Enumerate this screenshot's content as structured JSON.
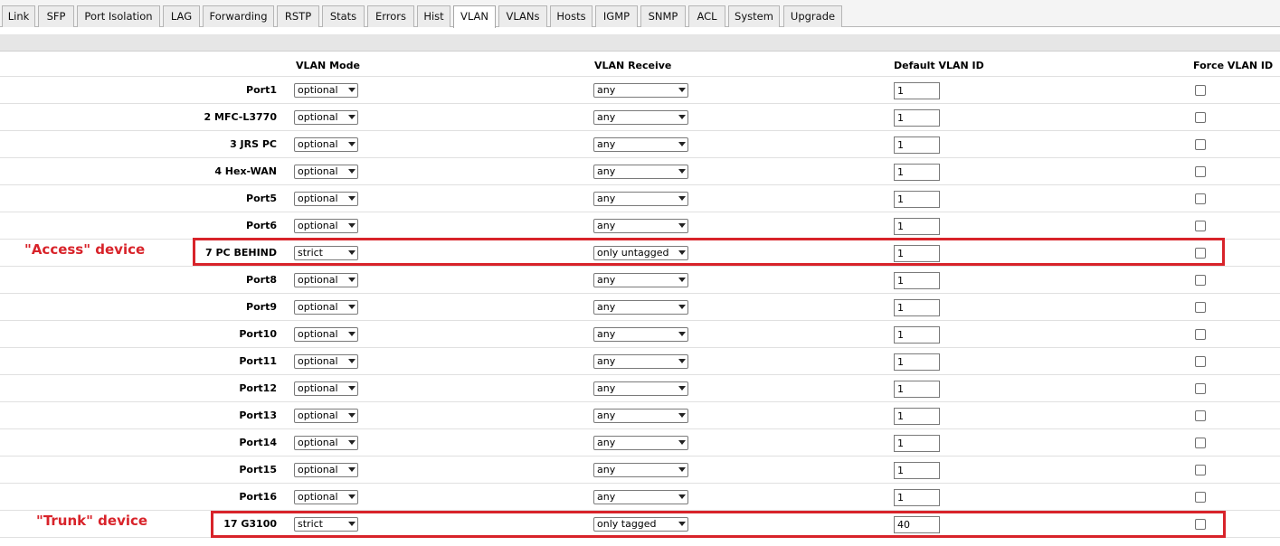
{
  "tabs": [
    {
      "label": "Link",
      "active": false
    },
    {
      "label": "SFP",
      "active": false
    },
    {
      "label": "Port Isolation",
      "active": false
    },
    {
      "label": "LAG",
      "active": false
    },
    {
      "label": "Forwarding",
      "active": false
    },
    {
      "label": "RSTP",
      "active": false
    },
    {
      "label": "Stats",
      "active": false
    },
    {
      "label": "Errors",
      "active": false
    },
    {
      "label": "Hist",
      "active": false
    },
    {
      "label": "VLAN",
      "active": true
    },
    {
      "label": "VLANs",
      "active": false
    },
    {
      "label": "Hosts",
      "active": false
    },
    {
      "label": "IGMP",
      "active": false
    },
    {
      "label": "SNMP",
      "active": false
    },
    {
      "label": "ACL",
      "active": false
    },
    {
      "label": "System",
      "active": false
    },
    {
      "label": "Upgrade",
      "active": false
    }
  ],
  "table": {
    "headers": {
      "vlan_mode": "VLAN Mode",
      "vlan_receive": "VLAN Receive",
      "default_vlan_id": "Default VLAN ID",
      "force_vlan_id": "Force VLAN ID"
    },
    "rows": [
      {
        "port": "Port1",
        "mode": "optional",
        "receive": "any",
        "vlan_id": "1",
        "force": false
      },
      {
        "port": "2 MFC-L3770",
        "mode": "optional",
        "receive": "any",
        "vlan_id": "1",
        "force": false
      },
      {
        "port": "3 JRS PC",
        "mode": "optional",
        "receive": "any",
        "vlan_id": "1",
        "force": false
      },
      {
        "port": "4 Hex-WAN",
        "mode": "optional",
        "receive": "any",
        "vlan_id": "1",
        "force": false
      },
      {
        "port": "Port5",
        "mode": "optional",
        "receive": "any",
        "vlan_id": "1",
        "force": false
      },
      {
        "port": "Port6",
        "mode": "optional",
        "receive": "any",
        "vlan_id": "1",
        "force": false
      },
      {
        "port": "7 PC BEHIND",
        "mode": "strict",
        "receive": "only untagged",
        "vlan_id": "1",
        "force": false
      },
      {
        "port": "Port8",
        "mode": "optional",
        "receive": "any",
        "vlan_id": "1",
        "force": false
      },
      {
        "port": "Port9",
        "mode": "optional",
        "receive": "any",
        "vlan_id": "1",
        "force": false
      },
      {
        "port": "Port10",
        "mode": "optional",
        "receive": "any",
        "vlan_id": "1",
        "force": false
      },
      {
        "port": "Port11",
        "mode": "optional",
        "receive": "any",
        "vlan_id": "1",
        "force": false
      },
      {
        "port": "Port12",
        "mode": "optional",
        "receive": "any",
        "vlan_id": "1",
        "force": false
      },
      {
        "port": "Port13",
        "mode": "optional",
        "receive": "any",
        "vlan_id": "1",
        "force": false
      },
      {
        "port": "Port14",
        "mode": "optional",
        "receive": "any",
        "vlan_id": "1",
        "force": false
      },
      {
        "port": "Port15",
        "mode": "optional",
        "receive": "any",
        "vlan_id": "1",
        "force": false
      },
      {
        "port": "Port16",
        "mode": "optional",
        "receive": "any",
        "vlan_id": "1",
        "force": false
      },
      {
        "port": "17 G3100",
        "mode": "strict",
        "receive": "only tagged",
        "vlan_id": "40",
        "force": false
      }
    ]
  },
  "annotations": {
    "access": "\"Access\" device",
    "trunk": "\"Trunk\" device",
    "color": "#d8232a"
  }
}
